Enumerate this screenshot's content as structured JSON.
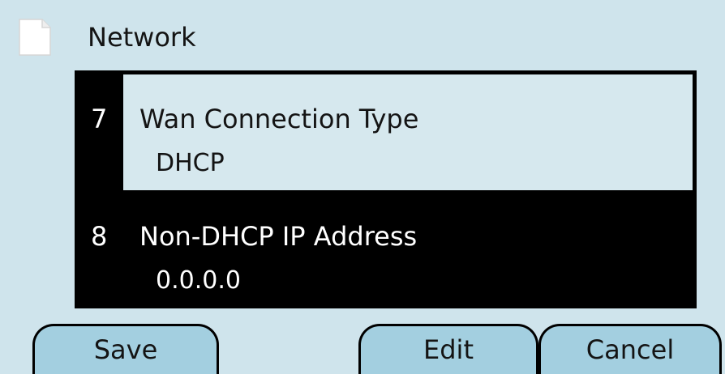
{
  "header": {
    "title": "Network",
    "icon": "document-icon"
  },
  "list": {
    "selected_index": 0,
    "items": [
      {
        "number": "7",
        "label": "Wan Connection Type",
        "value": "DHCP"
      },
      {
        "number": "8",
        "label": "Non-DHCP IP Address",
        "value": "0.0.0.0"
      }
    ]
  },
  "softkeys": {
    "save": "Save",
    "edit": "Edit",
    "cancel": "Cancel"
  },
  "colors": {
    "background": "#cfe4ec",
    "list_background": "#000000",
    "selected_row": "#d6e8ee",
    "softkey_fill": "#a3cfe0"
  }
}
